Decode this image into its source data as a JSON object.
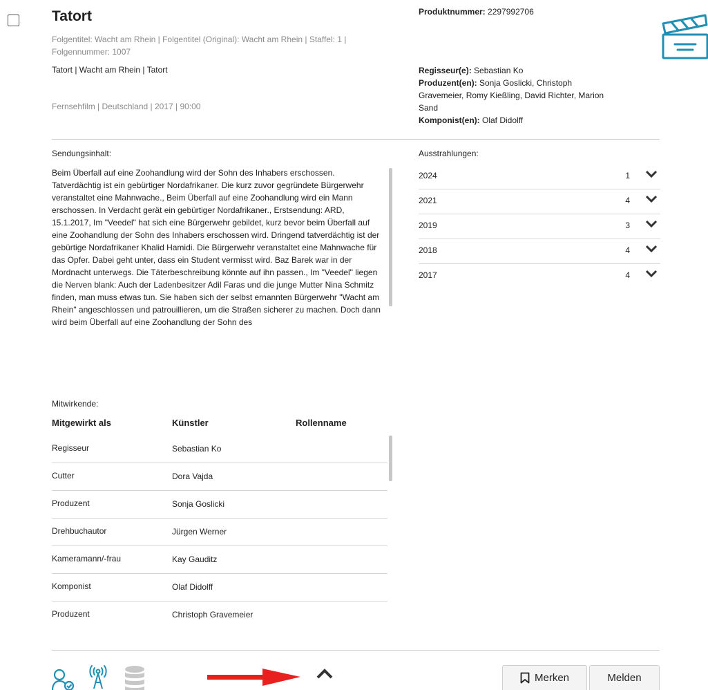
{
  "header": {
    "title": "Tatort",
    "subtitle": "Folgentitel: Wacht am Rhein | Folgentitel (Original): Wacht am Rhein | Staffel: 1 | Folgennummer: 1007",
    "series_line": "Tatort | Wacht am Rhein | Tatort",
    "meta_line": "Fernsehfilm | Deutschland | 2017 | 90:00"
  },
  "product": {
    "label": "Produktnummer:",
    "value": "2297992706"
  },
  "credits": {
    "director_label": "Regisseur(e):",
    "director_value": "Sebastian Ko",
    "producer_label": "Produzent(en):",
    "producer_value": "Sonja Goslicki, Christoph Gravemeier, Romy Kießling, David Richter, Marion Sand",
    "composer_label": "Komponist(en):",
    "composer_value": "Olaf Didolff"
  },
  "content": {
    "label": "Sendungsinhalt:",
    "text": "Beim Überfall auf eine Zoohandlung wird der Sohn des Inhabers erschossen. Tatverdächtig ist ein gebürtiger Nordafrikaner. Die kurz zuvor gegründete Bürgerwehr veranstaltet eine Mahnwache., Beim Überfall auf eine Zoohandlung wird ein Mann erschossen. In Verdacht gerät ein gebürtiger Nordafrikaner., Erstsendung: ARD, 15.1.2017, Im \"Veedel\" hat sich eine Bürgerwehr gebildet, kurz bevor beim Überfall auf eine Zoohandlung der Sohn des Inhabers erschossen wird. Dringend tatverdächtig ist der gebürtige Nordafrikaner Khalid Hamidi. Die Bürgerwehr veranstaltet eine Mahnwache für das Opfer. Dabei geht unter, dass ein Student vermisst wird. Baz Barek war in der Mordnacht unterwegs. Die Täterbeschreibung könnte auf ihn passen., Im \"Veedel\" liegen die Nerven blank: Auch der Ladenbesitzer Adil Faras und die junge Mutter Nina Schmitz finden, man muss etwas tun. Sie haben sich der selbst ernannten Bürgerwehr \"Wacht am Rhein\" angeschlossen und patrouillieren, um die Straßen sicherer zu machen. Doch dann wird beim Überfall auf eine Zoohandlung der Sohn des"
  },
  "airings": {
    "label": "Ausstrahlungen:",
    "rows": [
      {
        "year": "2024",
        "count": "1"
      },
      {
        "year": "2021",
        "count": "4"
      },
      {
        "year": "2019",
        "count": "3"
      },
      {
        "year": "2018",
        "count": "4"
      },
      {
        "year": "2017",
        "count": "4"
      }
    ]
  },
  "crew": {
    "label": "Mitwirkende:",
    "columns": [
      "Mitgewirkt als",
      "Künstler",
      "Rollenname"
    ],
    "rows": [
      {
        "role": "Regisseur",
        "artist": "Sebastian Ko"
      },
      {
        "role": "Cutter",
        "artist": "Dora Vajda"
      },
      {
        "role": "Produzent",
        "artist": "Sonja Goslicki"
      },
      {
        "role": "Drehbuchautor",
        "artist": "Jürgen Werner"
      },
      {
        "role": "Kameramann/-frau",
        "artist": "Kay Gauditz"
      },
      {
        "role": "Komponist",
        "artist": "Olaf Didolff"
      },
      {
        "role": "Produzent",
        "artist": "Christoph Gravemeier"
      }
    ]
  },
  "footer": {
    "merken_label": "Merken",
    "melden_label": "Melden"
  },
  "colors": {
    "accent": "#1f8fb3",
    "arrow": "#e8211f",
    "muted_icon": "#c8c8c8"
  },
  "icons": {
    "clapperboard": "clapperboard-icon",
    "user_check": "user-check-icon",
    "broadcast": "broadcast-icon",
    "database": "database-icon",
    "bookmark": "bookmark-icon"
  }
}
